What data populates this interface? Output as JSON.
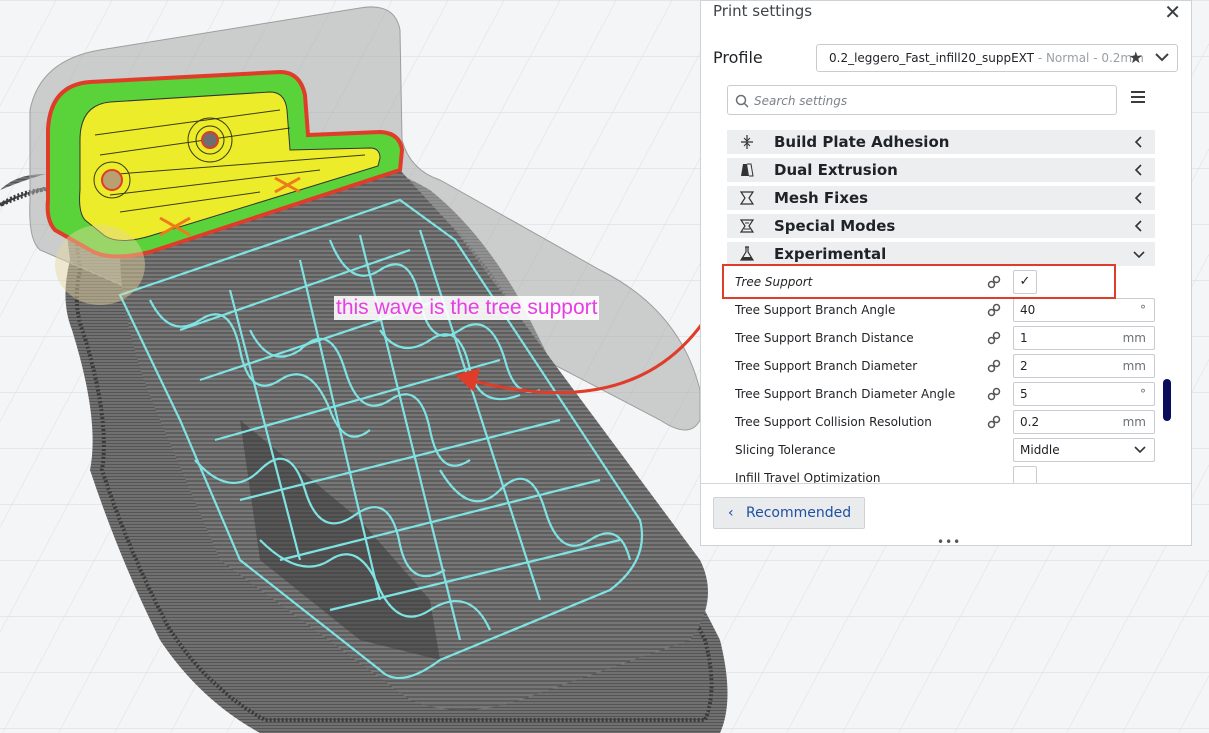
{
  "window": {
    "title": "Print settings"
  },
  "profile": {
    "label": "Profile",
    "name": "0.2_leggero_Fast_infill20_suppEXT",
    "detail": " - Normal - 0.2mm"
  },
  "search": {
    "placeholder": "Search settings"
  },
  "categories": [
    {
      "label": "Build Plate Adhesion",
      "icon": "adhesion-icon",
      "expanded": false
    },
    {
      "label": "Dual Extrusion",
      "icon": "dual-extrusion-icon",
      "expanded": false
    },
    {
      "label": "Mesh Fixes",
      "icon": "mesh-fixes-icon",
      "expanded": false
    },
    {
      "label": "Special Modes",
      "icon": "special-modes-icon",
      "expanded": false
    },
    {
      "label": "Experimental",
      "icon": "flask-icon",
      "expanded": true
    }
  ],
  "settings": [
    {
      "label": "Tree Support",
      "type": "checkbox",
      "value": "✓"
    },
    {
      "label": "Tree Support Branch Angle",
      "value": "40",
      "unit": "°"
    },
    {
      "label": "Tree Support Branch Distance",
      "value": "1",
      "unit": "mm"
    },
    {
      "label": "Tree Support Branch Diameter",
      "value": "2",
      "unit": "mm"
    },
    {
      "label": "Tree Support Branch Diameter Angle",
      "value": "5",
      "unit": "°"
    },
    {
      "label": "Tree Support Collision Resolution",
      "value": "0.2",
      "unit": "mm"
    },
    {
      "label": "Slicing Tolerance",
      "type": "select",
      "value": "Middle"
    },
    {
      "label": "Infill Travel Optimization",
      "type": "checkbox",
      "value": ""
    }
  ],
  "footer": {
    "recommended_label": "Recommended"
  },
  "annotation": {
    "text": "this wave is the tree support"
  },
  "colors": {
    "annotation_red": "#e03c2a",
    "annotation_text": "#e83ee5",
    "support_cyan": "#7fe3e3",
    "infill_yellow": "#ecec2a",
    "wall_green": "#5ad33a",
    "accent_blue": "#1d4fa6"
  }
}
